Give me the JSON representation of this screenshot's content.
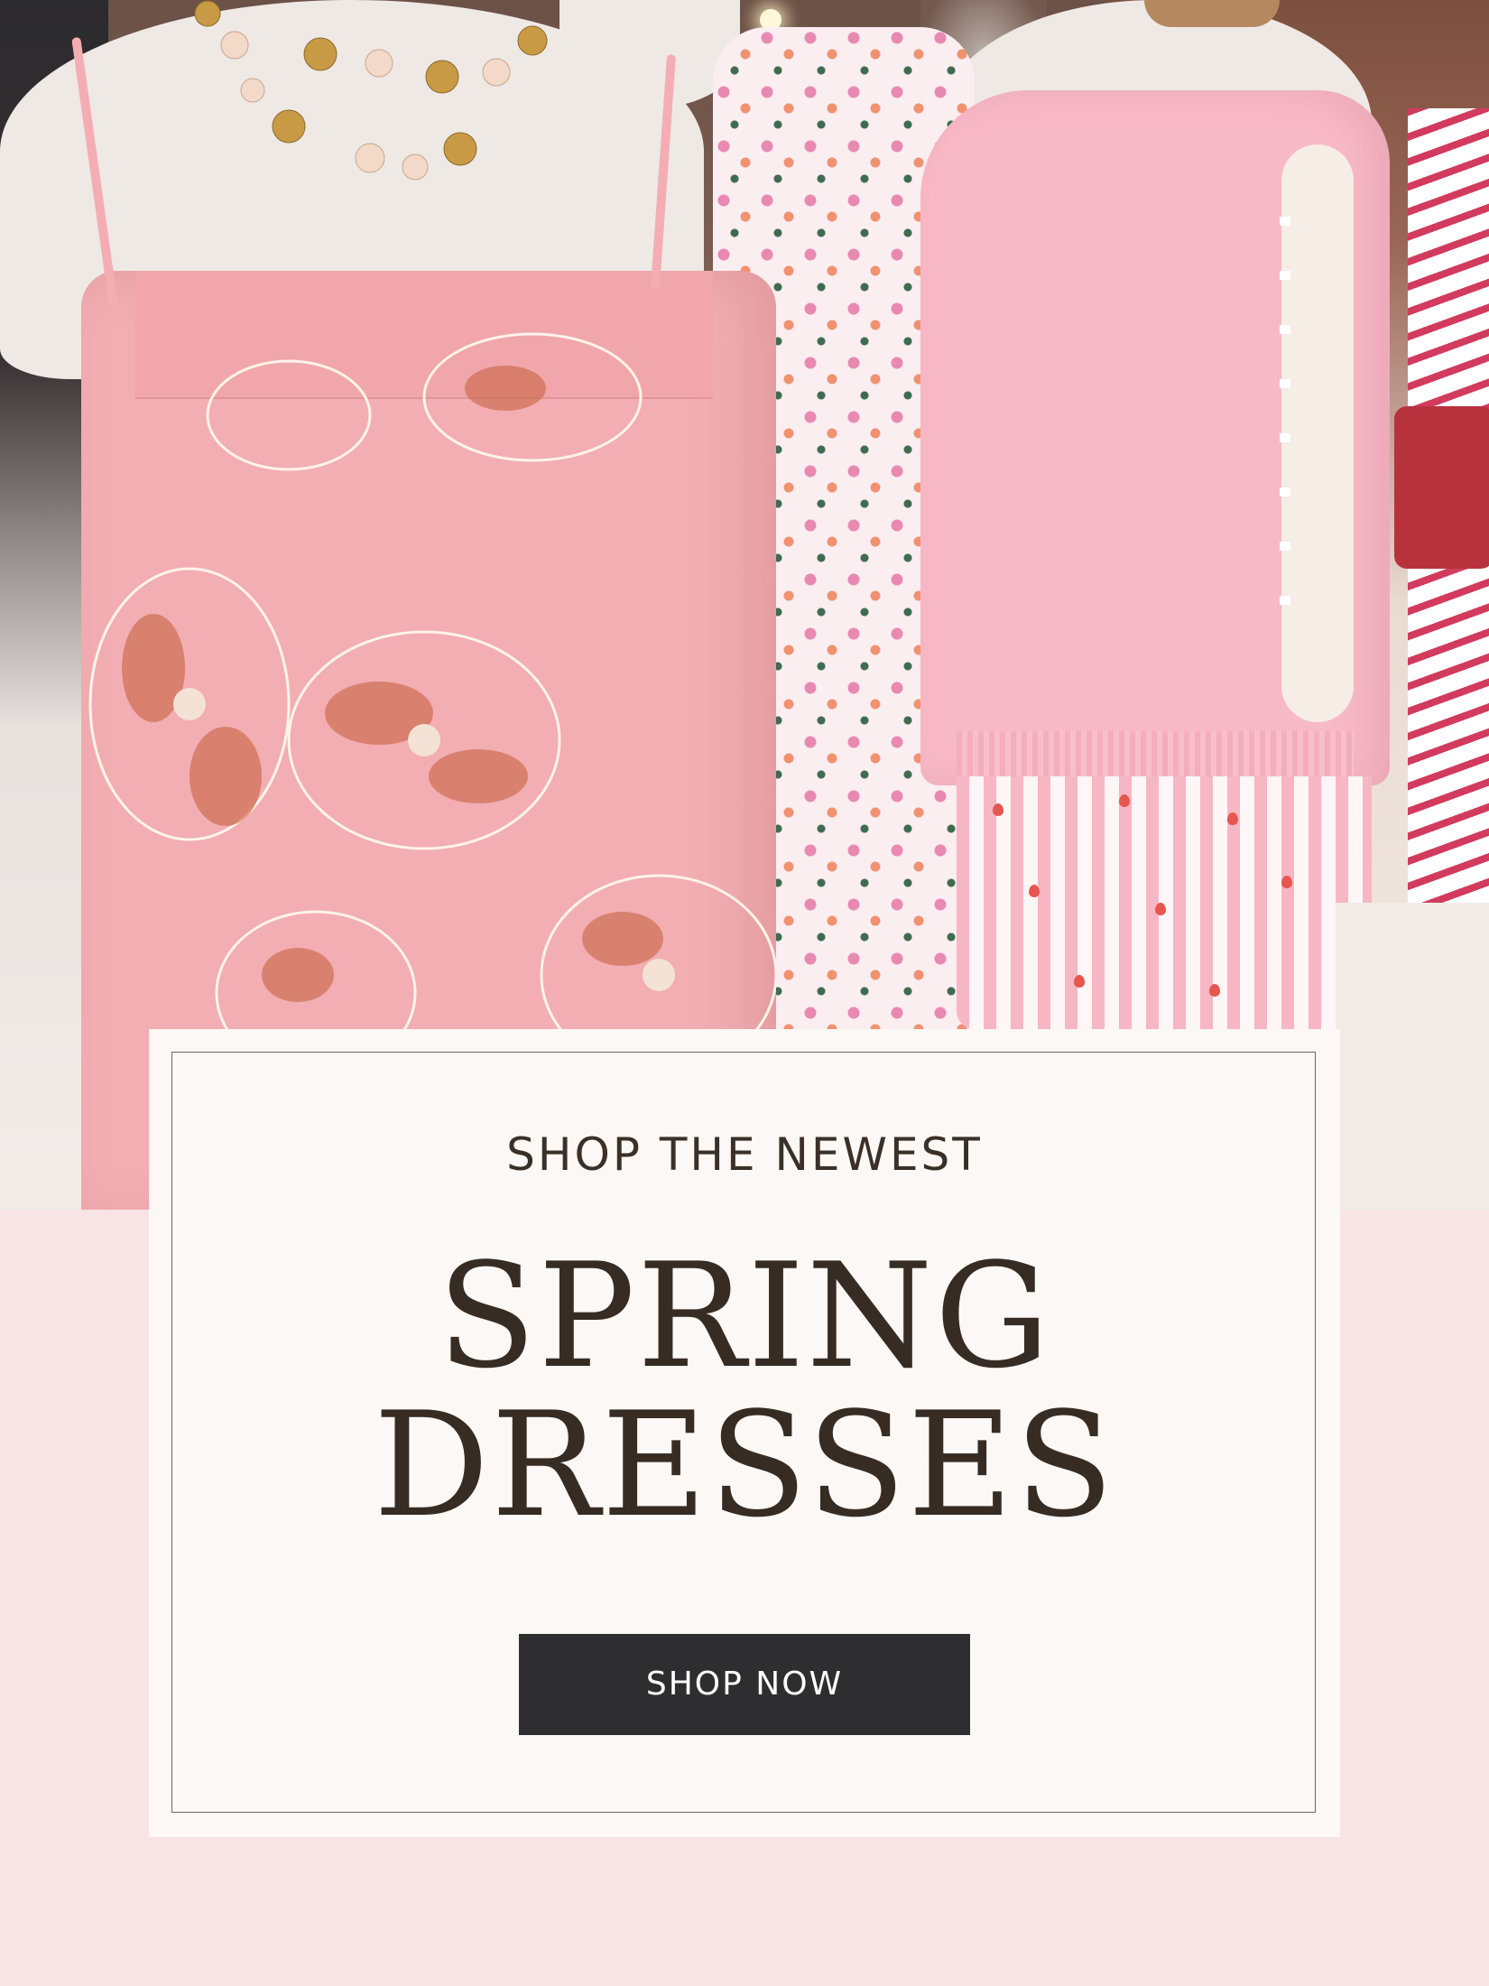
{
  "promo": {
    "eyebrow": "SHOP THE NEWEST",
    "headline_line1": "SPRING",
    "headline_line2": "DRESSES",
    "cta_label": "SHOP NOW"
  },
  "colors": {
    "page_background": "#f8e3e5",
    "card_background": "#fbf8f5",
    "text_dark": "#362c23",
    "button_background": "#2e2e30",
    "button_text": "#ffffff"
  }
}
